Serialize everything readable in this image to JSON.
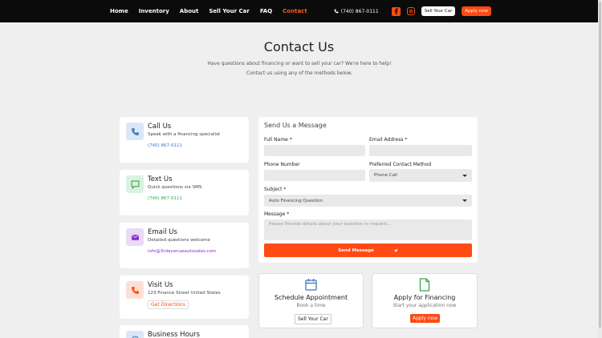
{
  "header": {
    "nav": [
      "Home",
      "Inventory",
      "About",
      "Sell Your Car",
      "FAQ",
      "Contact"
    ],
    "active_nav": "Contact",
    "phone": "(740) 867-0111",
    "sell_button": "Sell Your Car",
    "apply_button": "Apply now",
    "social_icons": [
      "facebook-icon",
      "instagram-icon"
    ]
  },
  "hero": {
    "title": "Contact Us",
    "subtitle": "Have questions about financing or want to sell your car? We're here to help! Contact us using any of the methods below."
  },
  "contact_methods": [
    {
      "title": "Call Us",
      "desc": "Speak with a financing specialist",
      "link": "(740) 867-0111",
      "icon": "phone-icon",
      "color": "#3b78c4",
      "bg": "#dbe7f6"
    },
    {
      "title": "Text Us",
      "desc": "Quick questions via SMS",
      "link": "(740) 867-0111",
      "icon": "message-icon",
      "color": "#38a64a",
      "bg": "#dcf1df"
    },
    {
      "title": "Email Us",
      "desc": "Detailed questions welcome",
      "link": "info@3rdavenueautosales.com",
      "icon": "email-icon",
      "color": "#8e2bd0",
      "bg": "#ead9f7"
    },
    {
      "title": "Visit Us",
      "desc": "123 Finance Street United States",
      "link": "Get Directions",
      "icon": "location-icon",
      "color": "#ff4a14",
      "bg": "#fde0d5"
    },
    {
      "title": "Business Hours",
      "icon": "clock-icon",
      "color": "#3b78c4",
      "bg": "#dbe7f6"
    }
  ],
  "form": {
    "title": "Send Us a Message",
    "full_name_label": "Full Name *",
    "email_label": "Email Address *",
    "phone_label": "Phone Number",
    "contact_method_label": "Preferred Contact Method",
    "contact_method_value": "Phone Call",
    "subject_label": "Subject *",
    "subject_value": "Auto Financing Question",
    "message_label": "Message *",
    "message_placeholder": "Please Provide details about your question or request...",
    "send_button": "Send Message"
  },
  "actions": [
    {
      "title": "Schedule Appointment",
      "subtitle": "Book a time",
      "button": "Sell Your Car",
      "icon": "calendar-icon"
    },
    {
      "title": "Apply for Financing",
      "subtitle": "Start your application now",
      "button": "Apply now",
      "icon": "document-icon"
    }
  ],
  "colors": {
    "accent": "#ff4a14",
    "header_bg": "#0b0b0b",
    "page_bg": "#efefef"
  }
}
